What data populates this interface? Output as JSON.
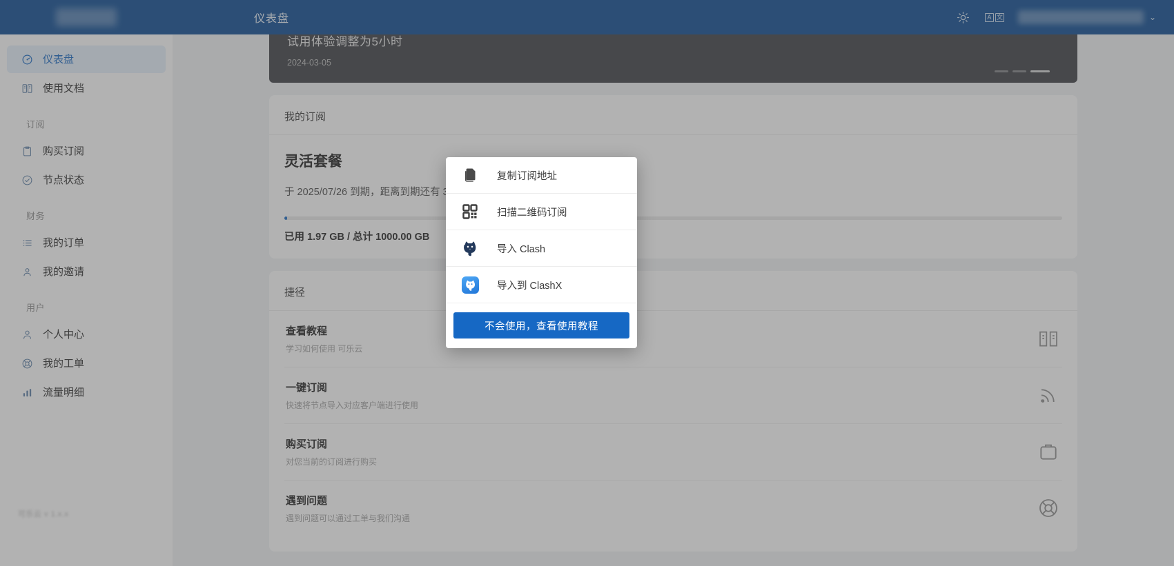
{
  "brand": {
    "logo_alt": "site-logo"
  },
  "header": {
    "title": "仪表盘",
    "theme_icon": "sun-icon",
    "language_icon": "translate-icon",
    "lang_latin": "A",
    "lang_cjk": "文",
    "chevron": "⌄"
  },
  "sidebar": {
    "footer_text": "可乐云 v 1.x.x",
    "items": [
      {
        "label": "仪表盘",
        "icon": "dashboard-icon",
        "active": true
      },
      {
        "label": "使用文档",
        "icon": "book-icon",
        "active": false
      }
    ],
    "groups": [
      {
        "title": "订阅",
        "items": [
          {
            "label": "购买订阅",
            "icon": "clipboard-icon"
          },
          {
            "label": "节点状态",
            "icon": "check-circle-icon"
          }
        ]
      },
      {
        "title": "财务",
        "items": [
          {
            "label": "我的订单",
            "icon": "list-icon"
          },
          {
            "label": "我的邀请",
            "icon": "user-add-icon"
          }
        ]
      },
      {
        "title": "用户",
        "items": [
          {
            "label": "个人中心",
            "icon": "user-icon"
          },
          {
            "label": "我的工单",
            "icon": "lifebuoy-icon"
          },
          {
            "label": "流量明细",
            "icon": "bar-chart-icon"
          }
        ]
      }
    ]
  },
  "banner": {
    "title": "试用体验调整为5小时",
    "date": "2024-03-05",
    "dots": 3,
    "active_dot_index": 2
  },
  "subscription": {
    "section_title": "我的订阅",
    "plan_name": "灵活套餐",
    "expire_text": "于 2025/07/26 到期，距离到期还有 333 天。",
    "usage_text": "已用 1.97 GB / 总计 1000.00 GB",
    "used_gb": 1.97,
    "total_gb": 1000.0,
    "progress_percent": 0.197,
    "accent_color": "#1668c4"
  },
  "shortcuts": {
    "section_title": "捷径",
    "items": [
      {
        "name": "查看教程",
        "desc": "学习如何使用 可乐云",
        "icon": "book-open-icon"
      },
      {
        "name": "一键订阅",
        "desc": "快速将节点导入对应客户端进行使用",
        "icon": "rss-icon"
      },
      {
        "name": "购买订阅",
        "desc": "对您当前的订阅进行购买",
        "icon": "briefcase-icon"
      },
      {
        "name": "遇到问题",
        "desc": "遇到问题可以通过工单与我们沟通",
        "icon": "lifebuoy-icon"
      }
    ]
  },
  "modal": {
    "items": [
      {
        "label": "复制订阅地址",
        "icon": "copy-icon"
      },
      {
        "label": "扫描二维码订阅",
        "icon": "qrcode-icon"
      },
      {
        "label": "导入 Clash",
        "icon": "clash-cat-icon"
      },
      {
        "label": "导入到 ClashX",
        "icon": "clashx-app-icon"
      }
    ],
    "cta_label": "不会使用，查看使用教程",
    "cta_color": "#1668c4"
  }
}
